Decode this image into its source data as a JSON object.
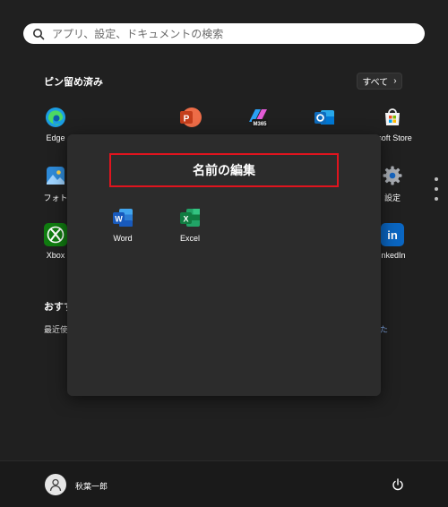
{
  "search": {
    "placeholder": "アプリ、設定、ドキュメントの検索",
    "icon": "search-icon"
  },
  "pinned": {
    "title": "ピン留め済み",
    "all_button": "すべて",
    "apps": [
      {
        "label": "Edge",
        "icon": "edge-icon",
        "color": "#0c7bd6"
      },
      {
        "label": "",
        "icon": "powerpoint-icon",
        "color": "#d35230"
      },
      {
        "label": "",
        "icon": "m365-copilot-icon",
        "badge": "M365",
        "color": "#8a5cf6"
      },
      {
        "label": "",
        "icon": "outlook-icon",
        "color": "#0f6cbd"
      },
      {
        "label": "osoft Store",
        "icon": "store-icon",
        "color": "#ffffff"
      },
      {
        "label": "フォト",
        "icon": "photos-icon",
        "color": "#2e8ad8"
      },
      {
        "label": "設定",
        "icon": "settings-icon",
        "color": "#9aa0a6"
      },
      {
        "label": "Xbox",
        "icon": "xbox-icon",
        "color": "#107c10"
      },
      {
        "label": "inkedIn",
        "icon": "linkedin-icon",
        "color": "#0a66c2"
      }
    ]
  },
  "recommended": {
    "title": "おすす",
    "subtitle": "最近使",
    "link": "た"
  },
  "folder": {
    "name": "名前の編集",
    "apps": [
      {
        "label": "Word",
        "icon": "word-icon",
        "letter": "W",
        "color": "#185abd"
      },
      {
        "label": "Excel",
        "icon": "excel-icon",
        "letter": "X",
        "color": "#107c41"
      }
    ]
  },
  "user": {
    "name": "秋葉一郎",
    "icon": "user-avatar-icon"
  },
  "power": {
    "icon": "power-icon"
  },
  "colors": {
    "background": "#202020",
    "folder": "#2c2c2c",
    "highlight": "#e0141e"
  }
}
